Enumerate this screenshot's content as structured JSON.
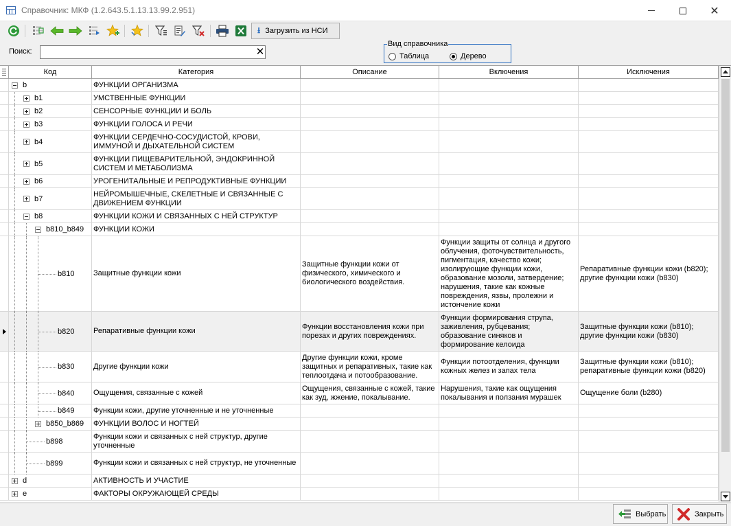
{
  "window": {
    "title": "Справочник: МКФ (1.2.643.5.1.13.13.99.2.951)"
  },
  "toolbar": {
    "load_nsi_label": "Загрузить из НСИ"
  },
  "search": {
    "label": "Поиск:",
    "value": ""
  },
  "view_mode": {
    "legend": "Вид справочника",
    "options": [
      {
        "label": "Таблица",
        "selected": false
      },
      {
        "label": "Дерево",
        "selected": true
      }
    ]
  },
  "grid": {
    "columns": [
      "Код",
      "Категория",
      "Описание",
      "Включения",
      "Исключения"
    ],
    "rows": [
      {
        "code": "b",
        "category": "ФУНКЦИИ ОРГАНИЗМА",
        "description": "",
        "inclusions": "",
        "exclusions": ""
      },
      {
        "code": "b1",
        "category": "УМСТВЕННЫЕ ФУНКЦИИ",
        "description": "",
        "inclusions": "",
        "exclusions": ""
      },
      {
        "code": "b2",
        "category": "СЕНСОРНЫЕ ФУНКЦИИ И БОЛЬ",
        "description": "",
        "inclusions": "",
        "exclusions": ""
      },
      {
        "code": "b3",
        "category": "ФУНКЦИИ ГОЛОСА И РЕЧИ",
        "description": "",
        "inclusions": "",
        "exclusions": ""
      },
      {
        "code": "b4",
        "category": "ФУНКЦИИ СЕРДЕЧНО-СОСУДИСТОЙ, КРОВИ, ИММУНОЙ И ДЫХАТЕЛЬНОЙ СИСТЕМ",
        "description": "",
        "inclusions": "",
        "exclusions": ""
      },
      {
        "code": "b5",
        "category": "ФУНКЦИИ ПИЩЕВАРИТЕЛЬНОЙ, ЭНДОКРИННОЙ СИСТЕМ И МЕТАБОЛИЗМА",
        "description": "",
        "inclusions": "",
        "exclusions": ""
      },
      {
        "code": "b6",
        "category": "УРОГЕНИТАЛЬНЫЕ И РЕПРОДУКТИВНЫЕ ФУНКЦИИ",
        "description": "",
        "inclusions": "",
        "exclusions": ""
      },
      {
        "code": "b7",
        "category": "НЕЙРОМЫШЕЧНЫЕ, СКЕЛЕТНЫЕ И СВЯЗАННЫЕ С ДВИЖЕНИЕМ ФУНКЦИИ",
        "description": "",
        "inclusions": "",
        "exclusions": ""
      },
      {
        "code": "b8",
        "category": "ФУНКЦИИ КОЖИ И СВЯЗАННЫХ С НЕЙ СТРУКТУР",
        "description": "",
        "inclusions": "",
        "exclusions": ""
      },
      {
        "code": "b810_b849",
        "category": "ФУНКЦИИ КОЖИ",
        "description": "",
        "inclusions": "",
        "exclusions": ""
      },
      {
        "code": "b810",
        "category": "Защитные функции кожи",
        "description": "Защитные функции кожи от физического, химического и биологического воздействия.",
        "inclusions": "Функции защиты от солнца и другого облучения, фоточувствительность, пигментация, качество кожи; изолирующие функции кожи, образование мозоли, затвердение; нарушения, такие как кожные повреждения, язвы, пролежни и истончение кожи",
        "exclusions": "Репаративные функции кожи (b820); другие функции кожи (b830)"
      },
      {
        "code": "b820",
        "category": "Репаративные функции кожи",
        "description": "Функции восстановления кожи при порезах и других повреждениях.",
        "inclusions": "Функции формирования струпа, заживления, рубцевания; образование синяков и формирование келоида",
        "exclusions": "Защитные функции кожи (b810); другие функции кожи (b830)"
      },
      {
        "code": "b830",
        "category": "Другие функции кожи",
        "description": "Другие функции кожи, кроме защитных и репаративных, такие как теплоотдача и потообразование.",
        "inclusions": "Функции потоотделения, функции кожных желез и запах тела",
        "exclusions": "Защитные функции кожи (b810); репаративные функции кожи (b820)"
      },
      {
        "code": "b840",
        "category": "Ощущения, связанные с кожей",
        "description": "Ощущения, связанные с кожей, такие как зуд, жжение, покалывание.",
        "inclusions": "Нарушения, такие как ощущения покалывания и ползания мурашек",
        "exclusions": "Ощущение боли (b280)"
      },
      {
        "code": "b849",
        "category": "Функции кожи, другие уточненные и не уточненные",
        "description": "",
        "inclusions": "",
        "exclusions": ""
      },
      {
        "code": "b850_b869",
        "category": "ФУНКЦИИ ВОЛОС И НОГТЕЙ",
        "description": "",
        "inclusions": "",
        "exclusions": ""
      },
      {
        "code": "b898",
        "category": "Функции кожи и связанных с ней структур, другие уточненные",
        "description": "",
        "inclusions": "",
        "exclusions": ""
      },
      {
        "code": "b899",
        "category": "Функции кожи и связанных с ней структур, не уточненные",
        "description": "",
        "inclusions": "",
        "exclusions": ""
      },
      {
        "code": "d",
        "category": "АКТИВНОСТЬ И УЧАСТИЕ",
        "description": "",
        "inclusions": "",
        "exclusions": ""
      },
      {
        "code": "e",
        "category": "ФАКТОРЫ ОКРУЖАЮЩЕЙ СРЕДЫ",
        "description": "",
        "inclusions": "",
        "exclusions": ""
      }
    ]
  },
  "footer": {
    "select_label": "Выбрать",
    "close_label": "Закрыть"
  },
  "colors": {
    "accent": "#2c6fc1",
    "green_icon": "#2e9a3a",
    "star_yellow": "#f3c11b",
    "close_red": "#d02a2a"
  }
}
